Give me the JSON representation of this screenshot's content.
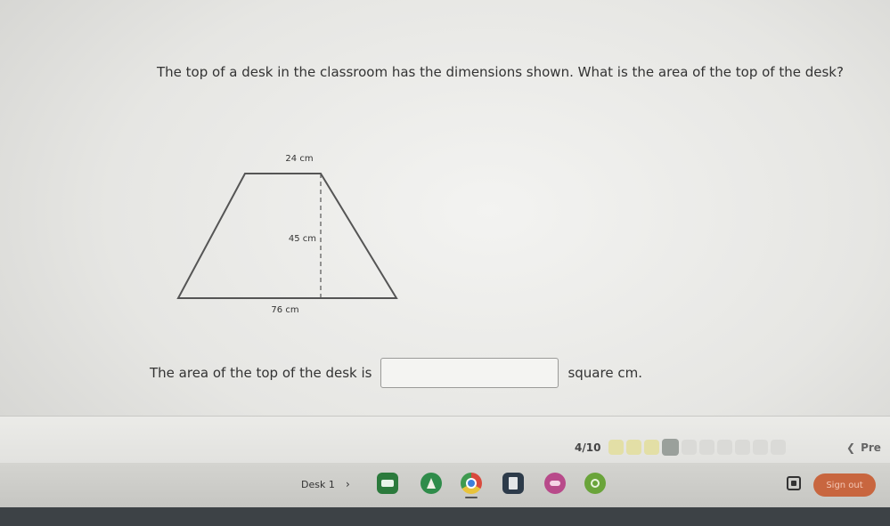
{
  "question": {
    "text": "The top of a desk in the classroom has the dimensions shown. What is the area of the top of the desk?"
  },
  "figure": {
    "top_base": "24 cm",
    "height": "45 cm",
    "bottom_base": "76 cm"
  },
  "answer": {
    "prefix": "The area of the top of the desk is",
    "value": "",
    "suffix": "square cm."
  },
  "progress": {
    "label": "4/10",
    "current": 4,
    "total": 10
  },
  "nav": {
    "prev_label": "Pre"
  },
  "shelf": {
    "desk_label": "Desk 1",
    "chevron": "›",
    "apps": [
      "classroom-app-icon",
      "sheets-app-icon",
      "chrome-icon",
      "docs-app-icon",
      "game-app-icon",
      "drawing-app-icon"
    ],
    "sign_out_label": "Sign out"
  },
  "colors": {
    "progress_done": "#e3dfa6",
    "progress_current": "#9aa09b",
    "sign_out": "#c8663f"
  }
}
